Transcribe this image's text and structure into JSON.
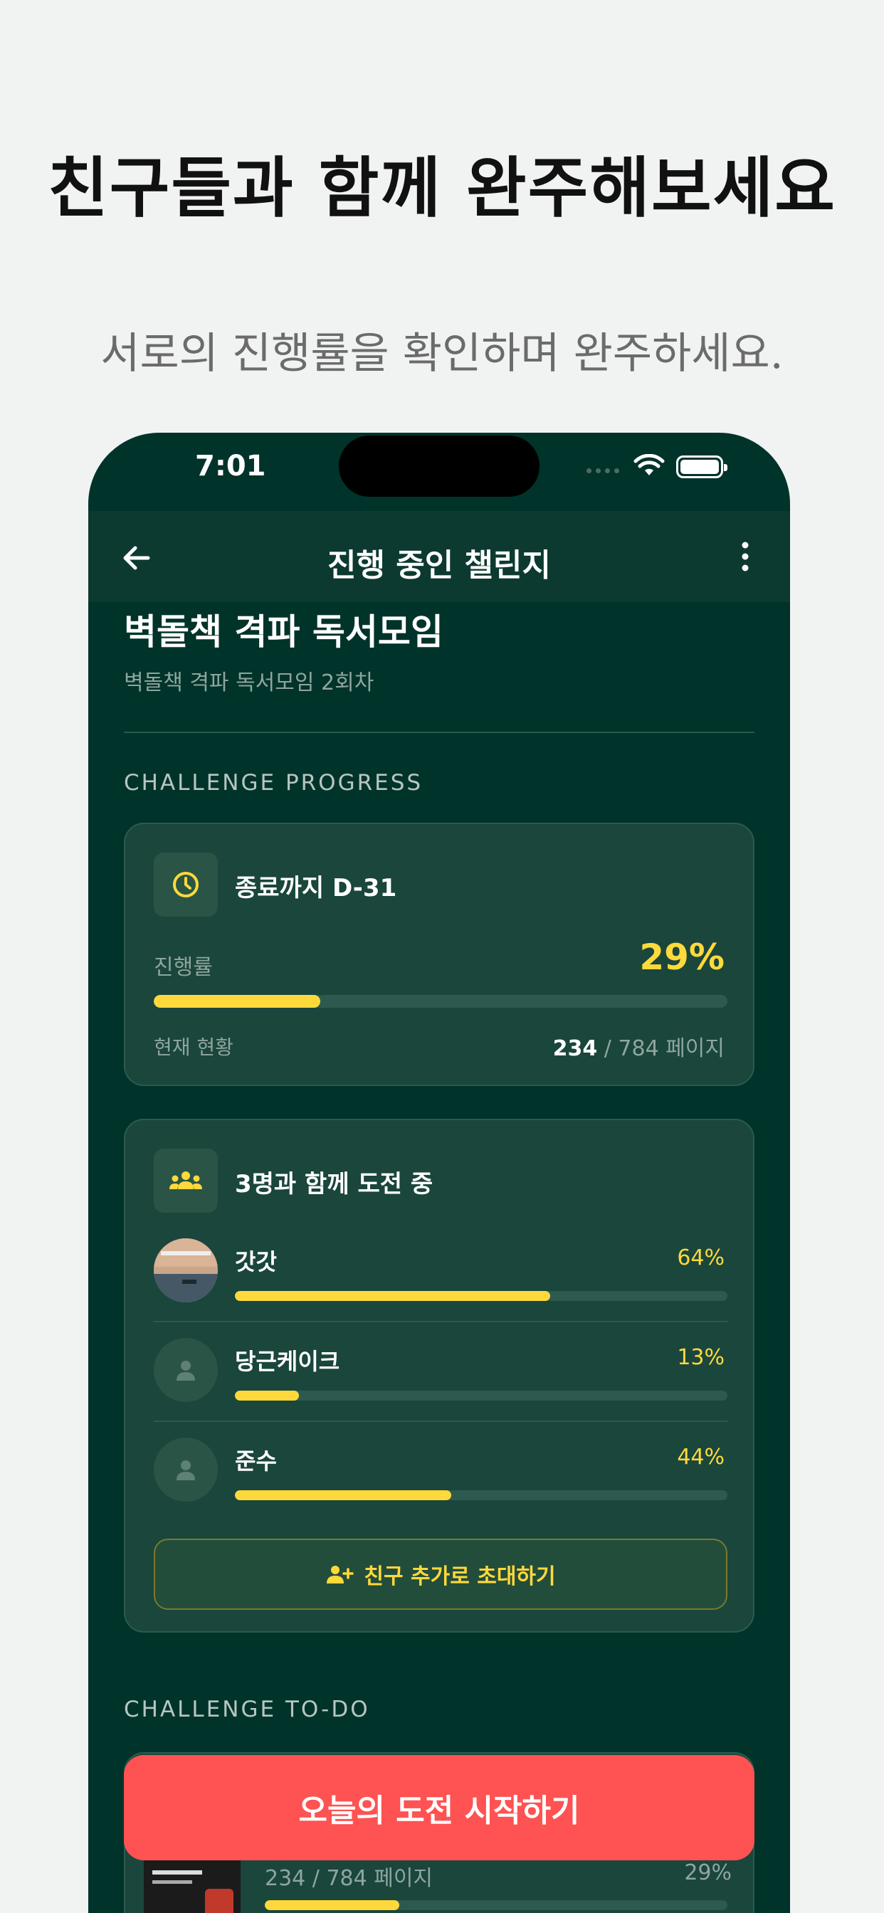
{
  "promo": {
    "headline": "친구들과 함께 완주해보세요",
    "subline": "서로의 진행률을 확인하며 완주하세요."
  },
  "status_bar": {
    "time": "7:01"
  },
  "nav": {
    "title": "진행 중인 챌린지"
  },
  "challenge": {
    "title": "벽돌책 격파 독서모임",
    "subtitle": "벽돌책 격파 독서모임 2회차"
  },
  "progress_section": {
    "label": "CHALLENGE PROGRESS",
    "deadline": "종료까지 D-31",
    "progress_label": "진행률",
    "progress_percent": "29%",
    "progress_value": 0.29,
    "current_label": "현재 현황",
    "current_pages": "234",
    "total_pages": "/ 784 페이지"
  },
  "group_section": {
    "heading": "3명과 함께 도전 중",
    "members": [
      {
        "name": "갓갓",
        "percent": "64%",
        "value": 0.64
      },
      {
        "name": "당근케이크",
        "percent": "13%",
        "value": 0.13
      },
      {
        "name": "준수",
        "percent": "44%",
        "value": 0.44
      }
    ],
    "invite_label": "친구 추가로 초대하기"
  },
  "todo_section": {
    "label": "CHALLENGE TO-DO",
    "item_pages": "234 / 784 페이지",
    "item_percent": "29%",
    "item_value": 0.29
  },
  "cta": {
    "label": "오늘의 도전 시작하기"
  },
  "colors": {
    "background": "#00332a",
    "card": "#1a463c",
    "accent": "#ffd93b",
    "cta": "#ff5252"
  }
}
